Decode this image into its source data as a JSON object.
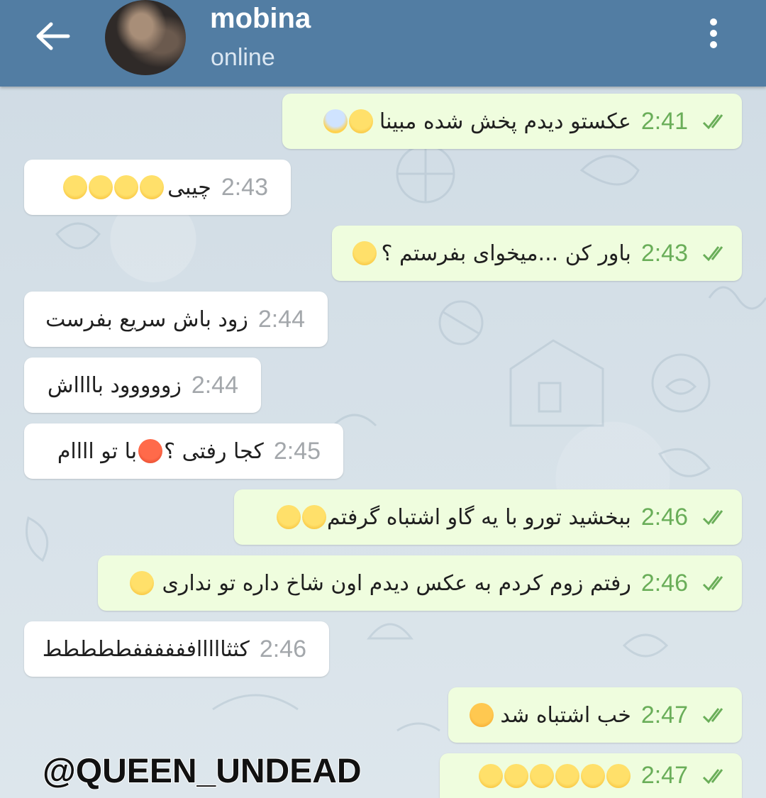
{
  "header": {
    "title": "mobina",
    "status": "online"
  },
  "messages": [
    {
      "dir": "out",
      "text": "عکستو دیدم پخش شده مبینا",
      "emojis": [
        "scream",
        "frown"
      ],
      "time": "2:41"
    },
    {
      "dir": "in",
      "text": "چیبی",
      "emojis": [
        "flushed",
        "flushed",
        "flushed",
        "flushed"
      ],
      "time": "2:43"
    },
    {
      "dir": "out",
      "text": "باور کن ...میخوای بفرستم ؟",
      "emojis": [
        "disappointed"
      ],
      "time": "2:43"
    },
    {
      "dir": "in",
      "text": "زود باش سریع بفرست",
      "emojis": [],
      "time": "2:44"
    },
    {
      "dir": "in",
      "text": "زووووود بااااش",
      "emojis": [],
      "time": "2:44"
    },
    {
      "dir": "in",
      "text": "کجا رفتی ؟",
      "emojis": [
        "angry"
      ],
      "text2": "با تو اااام",
      "time": "2:45"
    },
    {
      "dir": "out",
      "text": "ببخشید تورو با یه گاو اشتباه گرفتم",
      "emojis": [
        "grin",
        "joy"
      ],
      "time": "2:46"
    },
    {
      "dir": "out",
      "text": "رفتم زوم کردم به عکس دیدم اون شاخ داره تو نداری",
      "emojis": [
        "frown"
      ],
      "time": "2:46"
    },
    {
      "dir": "in",
      "text": "کثثاااااففففففططططط",
      "emojis": [],
      "time": "2:46"
    },
    {
      "dir": "out",
      "text": "خب اشتباه شد",
      "emojis": [
        "persevere"
      ],
      "time": "2:47"
    },
    {
      "dir": "out",
      "text": "",
      "emojis": [
        "rofl",
        "rofl",
        "rofl",
        "rofl",
        "rofl",
        "rofl"
      ],
      "time": "2:47"
    }
  ],
  "watermark": "@QUEEN_UNDEAD"
}
